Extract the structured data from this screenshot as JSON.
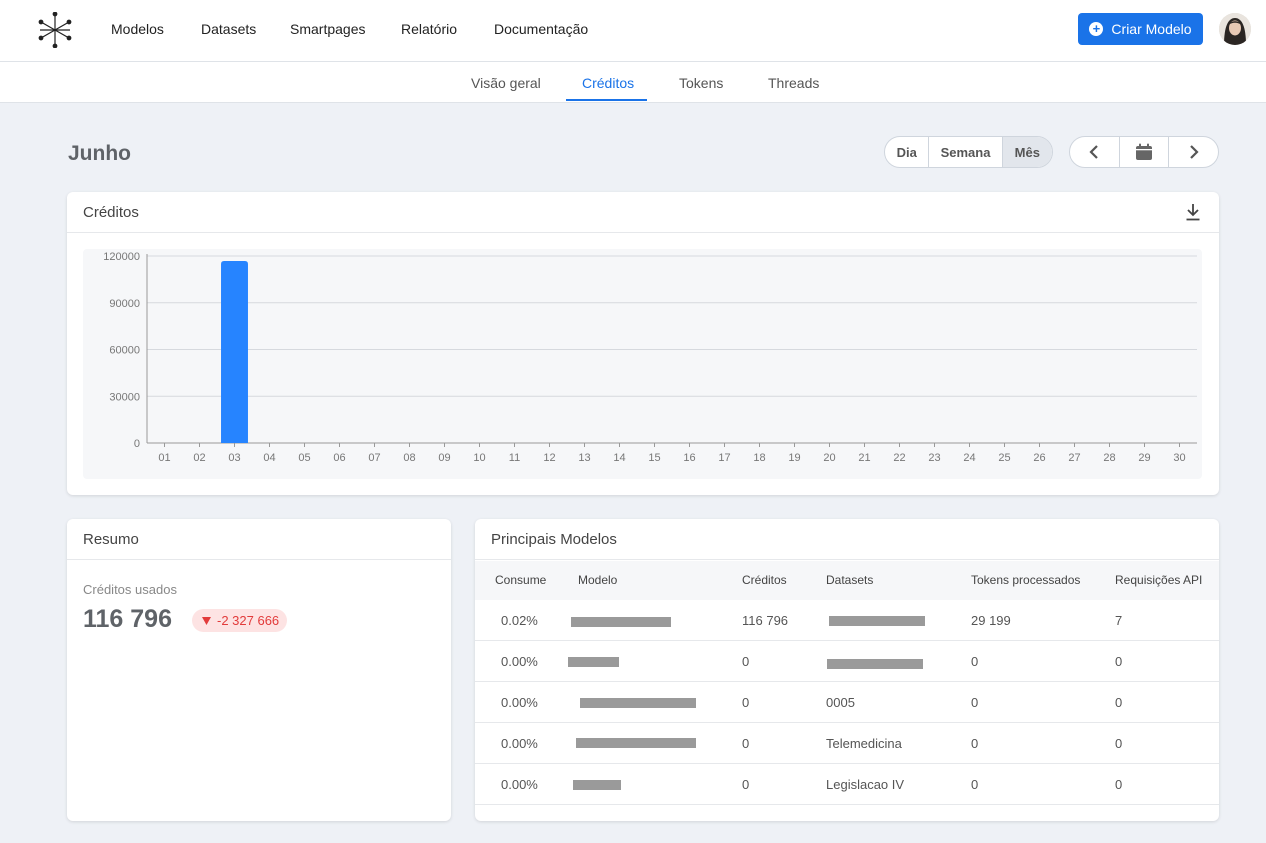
{
  "nav": {
    "links": [
      "Modelos",
      "Datasets",
      "Smartpages",
      "Relatório",
      "Documentação"
    ],
    "create_button": "Criar Modelo"
  },
  "tabs": [
    "Visão geral",
    "Créditos",
    "Tokens",
    "Threads"
  ],
  "active_tab": "Créditos",
  "page": {
    "title": "Junho",
    "period_options": [
      "Dia",
      "Semana",
      "Mês"
    ],
    "active_period": "Mês"
  },
  "credits_card": {
    "title": "Créditos"
  },
  "chart_data": {
    "type": "bar",
    "categories": [
      "01",
      "02",
      "03",
      "04",
      "05",
      "06",
      "07",
      "08",
      "09",
      "10",
      "11",
      "12",
      "13",
      "14",
      "15",
      "16",
      "17",
      "18",
      "19",
      "20",
      "21",
      "22",
      "23",
      "24",
      "25",
      "26",
      "27",
      "28",
      "29",
      "30"
    ],
    "values": [
      0,
      0,
      116796,
      0,
      0,
      0,
      0,
      0,
      0,
      0,
      0,
      0,
      0,
      0,
      0,
      0,
      0,
      0,
      0,
      0,
      0,
      0,
      0,
      0,
      0,
      0,
      0,
      0,
      0,
      0
    ],
    "ylim": [
      0,
      120000
    ],
    "yticks": [
      0,
      30000,
      60000,
      90000,
      120000
    ],
    "grid": true,
    "color": "#2684ff"
  },
  "resumo": {
    "title": "Resumo",
    "label": "Créditos usados",
    "value": "116 796",
    "delta": "-2 327 666",
    "delta_direction": "down"
  },
  "models": {
    "title": "Principais Modelos",
    "columns": [
      "Consume",
      "Modelo",
      "Créditos",
      "Datasets",
      "Tokens processados",
      "Requisições API"
    ],
    "rows": [
      {
        "consume": "0.02%",
        "modelo": "",
        "creditos": "116 796",
        "datasets": "",
        "tokens": "29 199",
        "requisicoes": "7"
      },
      {
        "consume": "0.00%",
        "modelo": "",
        "creditos": "0",
        "datasets": "",
        "tokens": "0",
        "requisicoes": "0"
      },
      {
        "consume": "0.00%",
        "modelo": "",
        "creditos": "0",
        "datasets": "0005",
        "tokens": "0",
        "requisicoes": "0"
      },
      {
        "consume": "0.00%",
        "modelo": "",
        "creditos": "0",
        "datasets": "Telemedicina",
        "tokens": "0",
        "requisicoes": "0"
      },
      {
        "consume": "0.00%",
        "modelo": "",
        "creditos": "0",
        "datasets": "Legislacao IV",
        "tokens": "0",
        "requisicoes": "0"
      }
    ]
  }
}
